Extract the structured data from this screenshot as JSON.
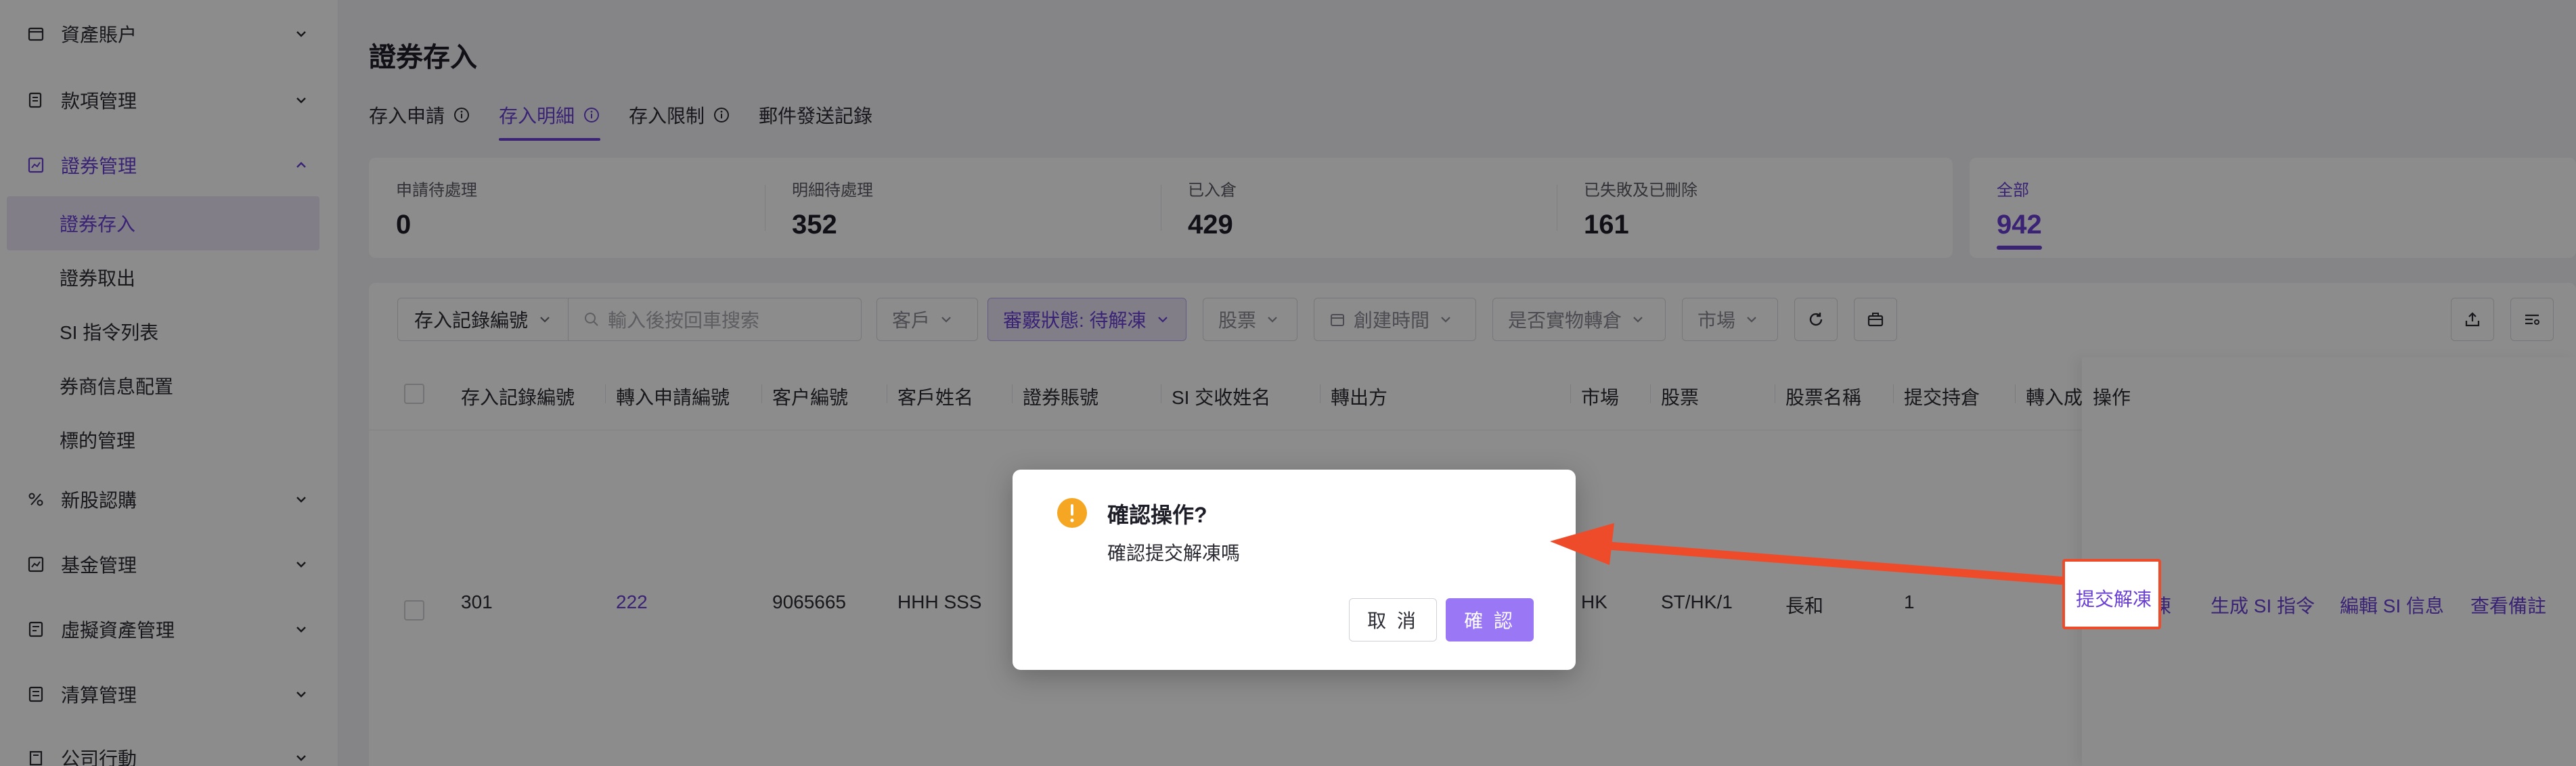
{
  "sidebar": {
    "items": [
      {
        "label": "資產賬户"
      },
      {
        "label": "款項管理"
      },
      {
        "label": "證券管理"
      },
      {
        "label": "新股認購"
      },
      {
        "label": "基金管理"
      },
      {
        "label": "虛擬資產管理"
      },
      {
        "label": "清算管理"
      },
      {
        "label": "公司行動"
      }
    ],
    "sub_items": [
      {
        "label": "證券存入"
      },
      {
        "label": "證券取出"
      },
      {
        "label": "SI 指令列表"
      },
      {
        "label": "券商信息配置"
      },
      {
        "label": "標的管理"
      }
    ]
  },
  "page": {
    "title": "證券存入",
    "tabs": [
      {
        "label": "存入申請"
      },
      {
        "label": "存入明細"
      },
      {
        "label": "存入限制"
      },
      {
        "label": "郵件發送記錄"
      }
    ]
  },
  "stats": [
    {
      "label": "申請待處理",
      "value": "0"
    },
    {
      "label": "明細待處理",
      "value": "352"
    },
    {
      "label": "已入倉",
      "value": "429"
    },
    {
      "label": "已失敗及已刪除",
      "value": "161"
    }
  ],
  "stat_all": {
    "label": "全部",
    "value": "942"
  },
  "filters": {
    "record_select": "存入記錄編號",
    "search_placeholder": "輸入後按回車搜索",
    "customer": "客戶",
    "review_status": "審覈狀態: 待解凍",
    "stock": "股票",
    "create_time": "創建時間",
    "physical_transfer": "是否實物轉倉",
    "market": "市場"
  },
  "table": {
    "headers": [
      "存入記錄編號",
      "轉入申請編號",
      "客户編號",
      "客戶姓名",
      "證券賬號",
      "SI 交收姓名",
      "轉出方",
      "市場",
      "股票",
      "股票名稱",
      "提交持倉",
      "轉入成",
      "操作"
    ],
    "row": {
      "record_no": "301",
      "apply_no": "222",
      "customer_no": "9065665",
      "customer_name": "HHH SSS",
      "market": "HK",
      "stock": "ST/HK/1",
      "stock_name": "長和",
      "submitted": "1"
    },
    "actions": [
      "提交解凍",
      "生成 SI 指令",
      "編輯 SI 信息",
      "查看備註"
    ]
  },
  "dialog": {
    "title": "確認操作?",
    "message": "確認提交解凍嗎",
    "cancel": "取 消",
    "confirm": "確 認"
  },
  "colors": {
    "accent": "#6a3fd6",
    "warning": "#f5a623",
    "annotation": "#ee4b2b"
  }
}
